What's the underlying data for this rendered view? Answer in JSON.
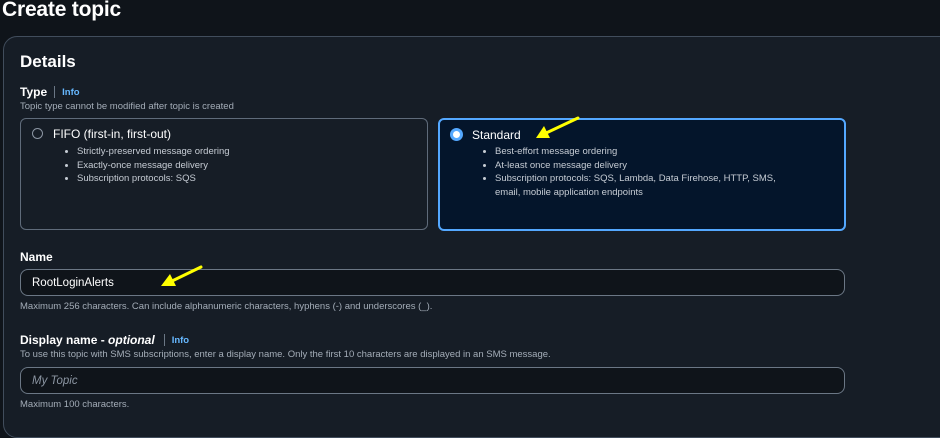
{
  "page": {
    "title": "Create topic"
  },
  "details": {
    "title": "Details",
    "type": {
      "label": "Type",
      "info": "Info",
      "hint": "Topic type cannot be modified after topic is created",
      "options": [
        {
          "title": "FIFO (first-in, first-out)",
          "selected": false,
          "bullets": [
            "Strictly-preserved message ordering",
            "Exactly-once message delivery",
            "Subscription protocols: SQS"
          ]
        },
        {
          "title": "Standard",
          "selected": true,
          "bullets": [
            "Best-effort message ordering",
            "At-least once message delivery",
            "Subscription protocols: SQS, Lambda, Data Firehose, HTTP, SMS,",
            "email, mobile application endpoints"
          ]
        }
      ]
    },
    "name": {
      "label": "Name",
      "value": "RootLoginAlerts",
      "hint": "Maximum 256 characters. Can include alphanumeric characters, hyphens (-) and underscores (_)."
    },
    "display_name": {
      "label": "Display name - ",
      "label_optional": "optional",
      "info": "Info",
      "hint": "To use this topic with SMS subscriptions, enter a display name. Only the first 10 characters are displayed in an SMS message.",
      "placeholder": "My Topic",
      "footer_hint": "Maximum 100 characters."
    }
  },
  "annotations": {
    "arrow_color": "#ffff00"
  },
  "colors": {
    "accent": "#54a8ff",
    "link": "#66b8ff",
    "background": "#0f141a"
  }
}
